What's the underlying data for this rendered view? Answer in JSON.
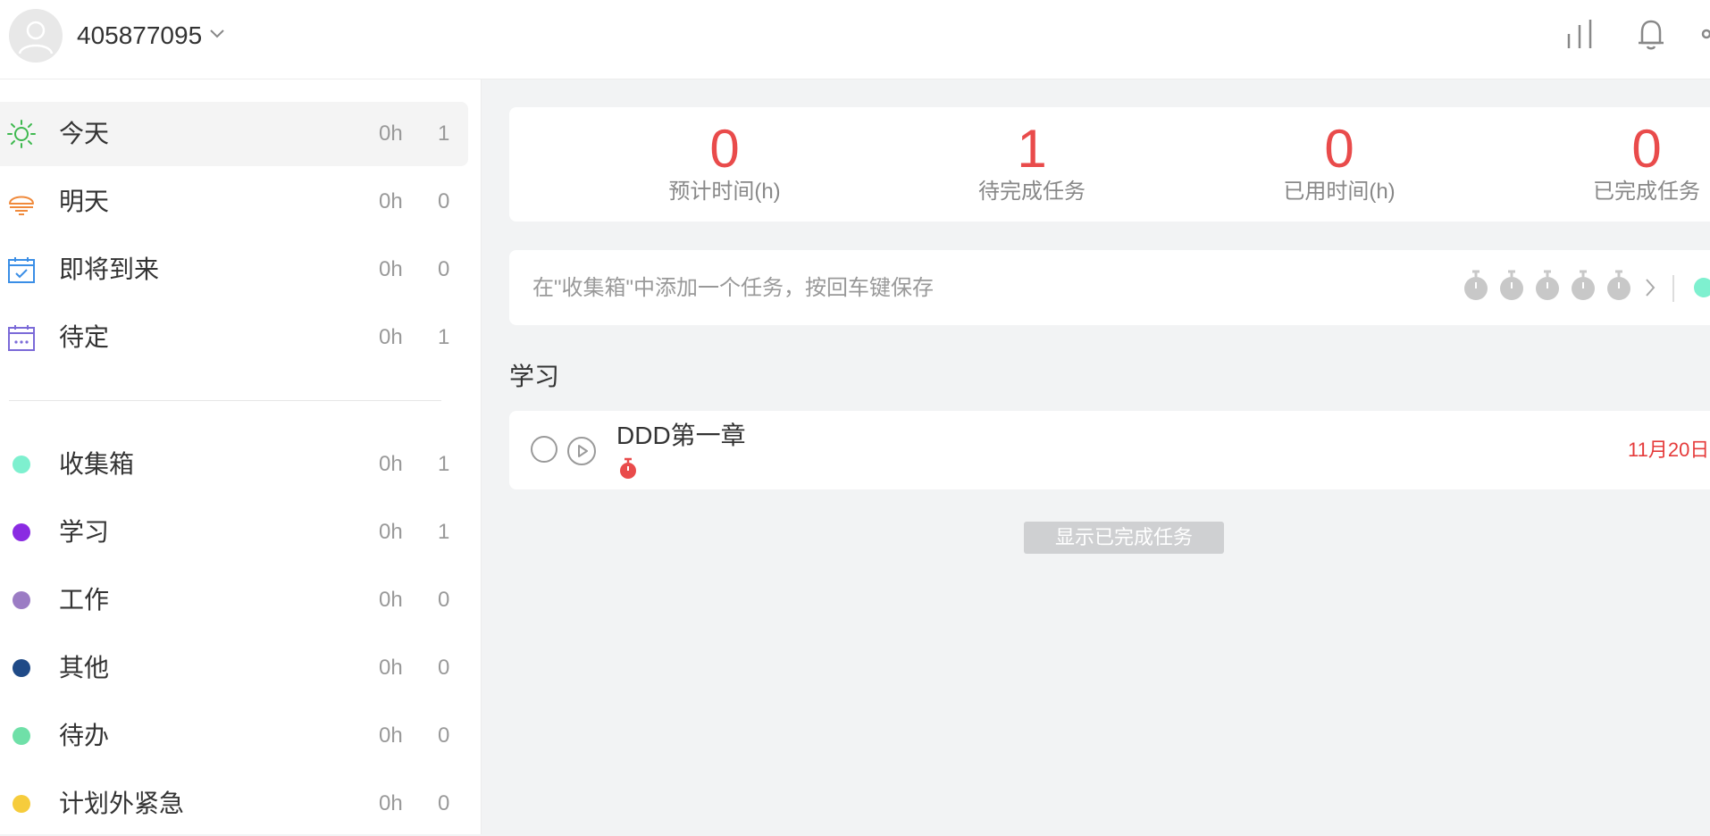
{
  "header": {
    "username": "405877095"
  },
  "sidebar": {
    "smart_lists": [
      {
        "label": "今天",
        "hours": "0h",
        "count": "1",
        "icon": "sun-icon",
        "color": "#3fb950"
      },
      {
        "label": "明天",
        "hours": "0h",
        "count": "0",
        "icon": "sunrise-icon",
        "color": "#f08a3c"
      },
      {
        "label": "即将到来",
        "hours": "0h",
        "count": "0",
        "icon": "calendar-check-icon",
        "color": "#3a8ee6"
      },
      {
        "label": "待定",
        "hours": "0h",
        "count": "1",
        "icon": "calendar-dots-icon",
        "color": "#7b6ad8"
      }
    ],
    "projects": [
      {
        "label": "收集箱",
        "hours": "0h",
        "count": "1",
        "color": "#7ef0cf"
      },
      {
        "label": "学习",
        "hours": "0h",
        "count": "1",
        "color": "#8a2be2"
      },
      {
        "label": "工作",
        "hours": "0h",
        "count": "0",
        "color": "#9b7cc4"
      },
      {
        "label": "其他",
        "hours": "0h",
        "count": "0",
        "color": "#1f4a87"
      },
      {
        "label": "待办",
        "hours": "0h",
        "count": "0",
        "color": "#6fe0a8"
      },
      {
        "label": "计划外紧急",
        "hours": "0h",
        "count": "0",
        "color": "#f6cc3c"
      }
    ]
  },
  "stats": [
    {
      "value": "0",
      "label": "预计时间(h)"
    },
    {
      "value": "1",
      "label": "待完成任务"
    },
    {
      "value": "0",
      "label": "已用时间(h)"
    },
    {
      "value": "0",
      "label": "已完成任务"
    }
  ],
  "task_input": {
    "placeholder": "在\"收集箱\"中添加一个任务，按回车键保存",
    "project_color": "#7ef0cf"
  },
  "task_group": {
    "title": "学习",
    "tasks": [
      {
        "title": "DDD第一章",
        "date": "11月20日"
      }
    ]
  },
  "show_completed_label": "显示已完成任务",
  "colors": {
    "accent_red": "#e94b4b",
    "muted_text": "#999999"
  }
}
